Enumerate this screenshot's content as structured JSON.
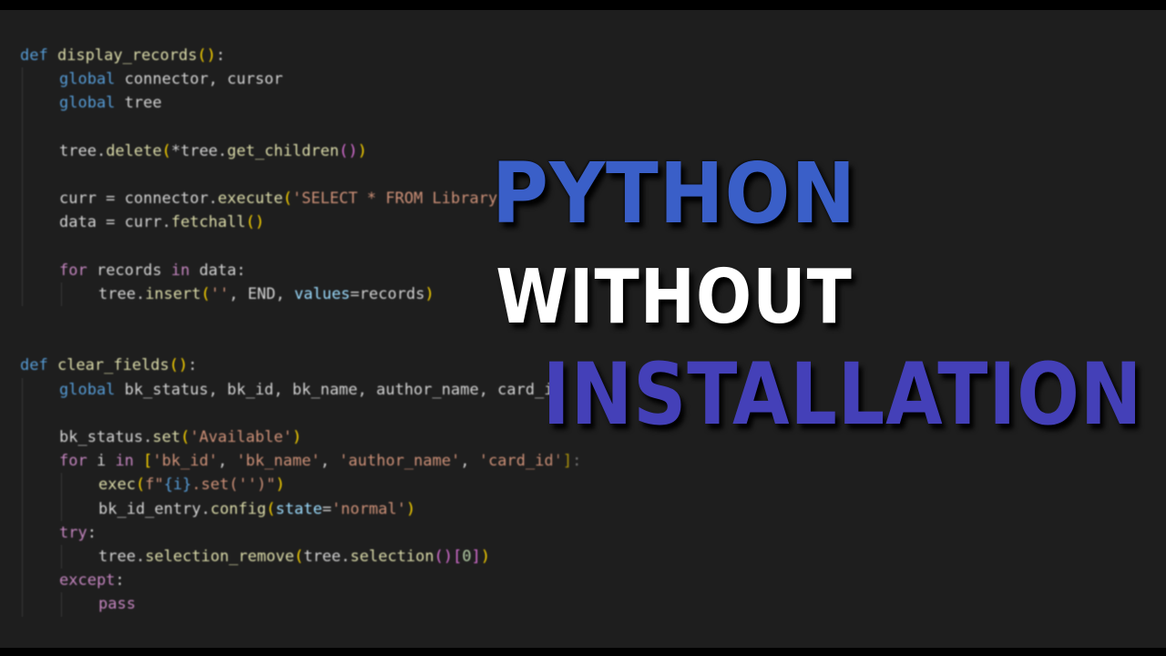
{
  "code_lines": [
    {
      "indent": 0,
      "segments": [
        {
          "t": "def ",
          "c": "kw"
        },
        {
          "t": "display_records",
          "c": "fn"
        },
        {
          "t": "()",
          "c": "p1"
        },
        {
          "t": ":",
          "c": "var"
        }
      ]
    },
    {
      "indent": 1,
      "segments": [
        {
          "t": "global ",
          "c": "kw"
        },
        {
          "t": "connector, cursor",
          "c": "var"
        }
      ]
    },
    {
      "indent": 1,
      "segments": [
        {
          "t": "global ",
          "c": "kw"
        },
        {
          "t": "tree",
          "c": "var"
        }
      ]
    },
    {
      "indent": 1,
      "segments": []
    },
    {
      "indent": 1,
      "segments": [
        {
          "t": "tree.",
          "c": "var"
        },
        {
          "t": "delete",
          "c": "fn"
        },
        {
          "t": "(",
          "c": "p1"
        },
        {
          "t": "*tree.",
          "c": "var"
        },
        {
          "t": "get_children",
          "c": "fn"
        },
        {
          "t": "()",
          "c": "p2"
        },
        {
          "t": ")",
          "c": "p1"
        }
      ]
    },
    {
      "indent": 1,
      "segments": []
    },
    {
      "indent": 1,
      "segments": [
        {
          "t": "curr = connector.",
          "c": "var"
        },
        {
          "t": "execute",
          "c": "fn"
        },
        {
          "t": "(",
          "c": "p1"
        },
        {
          "t": "'SELECT * FROM Library'",
          "c": "str"
        },
        {
          "t": ")",
          "c": "p1"
        }
      ]
    },
    {
      "indent": 1,
      "segments": [
        {
          "t": "data = curr.",
          "c": "var"
        },
        {
          "t": "fetchall",
          "c": "fn"
        },
        {
          "t": "()",
          "c": "p1"
        }
      ]
    },
    {
      "indent": 1,
      "segments": []
    },
    {
      "indent": 1,
      "segments": [
        {
          "t": "for ",
          "c": "ctl"
        },
        {
          "t": "records ",
          "c": "var"
        },
        {
          "t": "in ",
          "c": "ctl"
        },
        {
          "t": "data:",
          "c": "var"
        }
      ]
    },
    {
      "indent": 2,
      "segments": [
        {
          "t": "tree.",
          "c": "var"
        },
        {
          "t": "insert",
          "c": "fn"
        },
        {
          "t": "(",
          "c": "p1"
        },
        {
          "t": "''",
          "c": "str"
        },
        {
          "t": ", END, ",
          "c": "var"
        },
        {
          "t": "values",
          "c": "param"
        },
        {
          "t": "=records",
          "c": "var"
        },
        {
          "t": ")",
          "c": "p1"
        }
      ]
    },
    {
      "indent": 0,
      "segments": []
    },
    {
      "indent": 0,
      "segments": []
    },
    {
      "indent": 0,
      "segments": [
        {
          "t": "def ",
          "c": "kw"
        },
        {
          "t": "clear_fields",
          "c": "fn"
        },
        {
          "t": "()",
          "c": "p1"
        },
        {
          "t": ":",
          "c": "var"
        }
      ]
    },
    {
      "indent": 1,
      "segments": [
        {
          "t": "global ",
          "c": "kw"
        },
        {
          "t": "bk_status, bk_id, bk_name, author_name, card_id",
          "c": "var"
        }
      ]
    },
    {
      "indent": 1,
      "segments": []
    },
    {
      "indent": 1,
      "segments": [
        {
          "t": "bk_status.",
          "c": "var"
        },
        {
          "t": "set",
          "c": "fn"
        },
        {
          "t": "(",
          "c": "p1"
        },
        {
          "t": "'Available'",
          "c": "str"
        },
        {
          "t": ")",
          "c": "p1"
        }
      ]
    },
    {
      "indent": 1,
      "segments": [
        {
          "t": "for ",
          "c": "ctl"
        },
        {
          "t": "i ",
          "c": "var"
        },
        {
          "t": "in ",
          "c": "ctl"
        },
        {
          "t": "[",
          "c": "p1"
        },
        {
          "t": "'bk_id'",
          "c": "str"
        },
        {
          "t": ", ",
          "c": "var"
        },
        {
          "t": "'bk_name'",
          "c": "str"
        },
        {
          "t": ", ",
          "c": "var"
        },
        {
          "t": "'author_name'",
          "c": "str"
        },
        {
          "t": ", ",
          "c": "var"
        },
        {
          "t": "'card_id'",
          "c": "str"
        },
        {
          "t": "]",
          "c": "p1"
        },
        {
          "t": ":",
          "c": "var"
        }
      ]
    },
    {
      "indent": 2,
      "segments": [
        {
          "t": "exec",
          "c": "fn"
        },
        {
          "t": "(",
          "c": "p1"
        },
        {
          "t": "f\"",
          "c": "str"
        },
        {
          "t": "{i}",
          "c": "kw"
        },
        {
          "t": ".set('')\"",
          "c": "str"
        },
        {
          "t": ")",
          "c": "p1"
        }
      ]
    },
    {
      "indent": 2,
      "segments": [
        {
          "t": "bk_id_entry.",
          "c": "var"
        },
        {
          "t": "config",
          "c": "fn"
        },
        {
          "t": "(",
          "c": "p1"
        },
        {
          "t": "state",
          "c": "param"
        },
        {
          "t": "=",
          "c": "var"
        },
        {
          "t": "'normal'",
          "c": "str"
        },
        {
          "t": ")",
          "c": "p1"
        }
      ]
    },
    {
      "indent": 1,
      "segments": [
        {
          "t": "try",
          "c": "ctl"
        },
        {
          "t": ":",
          "c": "var"
        }
      ]
    },
    {
      "indent": 2,
      "segments": [
        {
          "t": "tree.",
          "c": "var"
        },
        {
          "t": "selection_remove",
          "c": "fn"
        },
        {
          "t": "(",
          "c": "p1"
        },
        {
          "t": "tree.",
          "c": "var"
        },
        {
          "t": "selection",
          "c": "fn"
        },
        {
          "t": "()",
          "c": "p2"
        },
        {
          "t": "[",
          "c": "p2"
        },
        {
          "t": "0",
          "c": "num"
        },
        {
          "t": "]",
          "c": "p2"
        },
        {
          "t": ")",
          "c": "p1"
        }
      ]
    },
    {
      "indent": 1,
      "segments": [
        {
          "t": "except",
          "c": "ctl"
        },
        {
          "t": ":",
          "c": "var"
        }
      ]
    },
    {
      "indent": 2,
      "segments": [
        {
          "t": "pass",
          "c": "ctl"
        }
      ]
    }
  ],
  "overlay": {
    "line1": "PYTHON",
    "line2": "WITHOUT",
    "line3": "INSTALLATION"
  },
  "colors": {
    "editor_bg": "#1e1e1e",
    "title_blue": "#3a5fc8",
    "title_white": "#ffffff",
    "title_indigo": "#4440b8"
  }
}
